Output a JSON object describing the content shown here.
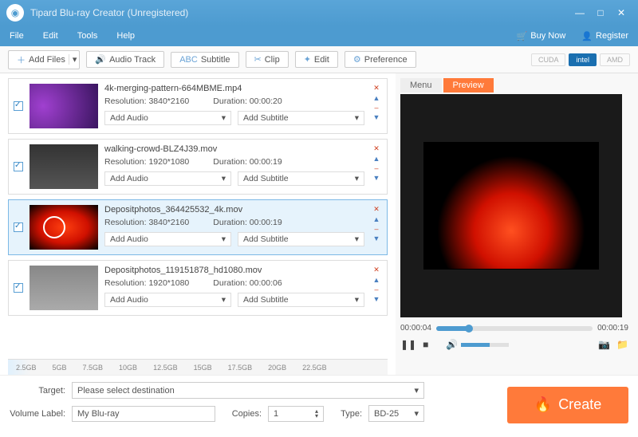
{
  "window": {
    "title": "Tipard Blu-ray Creator (Unregistered)"
  },
  "menu": {
    "file": "File",
    "edit": "Edit",
    "tools": "Tools",
    "help": "Help",
    "buy": "Buy Now",
    "register": "Register"
  },
  "toolbar": {
    "add_files": "Add Files",
    "audio_track": "Audio Track",
    "subtitle": "Subtitle",
    "clip": "Clip",
    "edit": "Edit",
    "preference": "Preference",
    "gpu_cuda": "CUDA",
    "gpu_intel": "intel",
    "gpu_amd": "AMD"
  },
  "labels": {
    "resolution": "Resolution:",
    "duration": "Duration:",
    "add_audio": "Add Audio",
    "add_subtitle": "Add Subtitle"
  },
  "files": [
    {
      "name": "4k-merging-pattern-664MBME.mp4",
      "resolution": "3840*2160",
      "duration": "00:00:20"
    },
    {
      "name": "walking-crowd-BLZ4J39.mov",
      "resolution": "1920*1080",
      "duration": "00:00:19"
    },
    {
      "name": "Depositphotos_364425532_4k.mov",
      "resolution": "3840*2160",
      "duration": "00:00:19"
    },
    {
      "name": "Depositphotos_119151878_hd1080.mov",
      "resolution": "1920*1080",
      "duration": "00:00:06"
    }
  ],
  "ruler": [
    "2.5GB",
    "5GB",
    "7.5GB",
    "10GB",
    "12.5GB",
    "15GB",
    "17.5GB",
    "20GB",
    "22.5GB"
  ],
  "preview": {
    "tab_menu": "Menu",
    "tab_preview": "Preview",
    "current": "00:00:04",
    "total": "00:00:19",
    "progress_pct": 21
  },
  "bottom": {
    "target_label": "Target:",
    "target_value": "Please select destination",
    "volume_label": "Volume Label:",
    "volume_value": "My Blu-ray",
    "copies_label": "Copies:",
    "copies_value": "1",
    "type_label": "Type:",
    "type_value": "BD-25",
    "create": "Create"
  }
}
